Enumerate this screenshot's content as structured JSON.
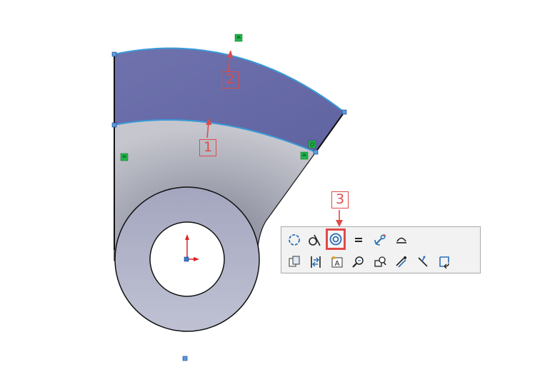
{
  "callouts": [
    {
      "id": "1",
      "label": "1"
    },
    {
      "id": "2",
      "label": "2"
    },
    {
      "id": "3",
      "label": "3"
    }
  ],
  "context_toolbar": {
    "row1": [
      {
        "icon": "make-fix-circle-icon",
        "name": "tool-arc-relation"
      },
      {
        "icon": "tangent-relation-icon",
        "name": "tool-tangent"
      },
      {
        "icon": "concentric-relation-icon",
        "name": "tool-concentric",
        "highlighted": true
      },
      {
        "icon": "equal-relation-icon",
        "name": "tool-equal"
      },
      {
        "icon": "fix-relation-icon",
        "name": "tool-fix"
      },
      {
        "icon": "arc-relation-icon",
        "name": "tool-coradial"
      }
    ],
    "row2": [
      {
        "icon": "copy-entities-icon",
        "name": "tool-copy"
      },
      {
        "icon": "swap-icon",
        "name": "tool-swap"
      },
      {
        "icon": "smart-text-icon",
        "name": "tool-text"
      },
      {
        "icon": "zoom-selection-icon",
        "name": "tool-zoom"
      },
      {
        "icon": "display-relations-icon",
        "name": "tool-display-relations"
      },
      {
        "icon": "fully-define-icon",
        "name": "tool-fully-define"
      },
      {
        "icon": "trim-icon",
        "name": "tool-trim"
      },
      {
        "icon": "exit-sketch-icon",
        "name": "tool-exit"
      }
    ]
  },
  "colors": {
    "highlight_face": "#6b6fa8",
    "part_face": "#9ea0b0",
    "selection_edge": "#3a9ad9",
    "callout": "#e04a4a",
    "relation_marker": "#1fb84a"
  }
}
